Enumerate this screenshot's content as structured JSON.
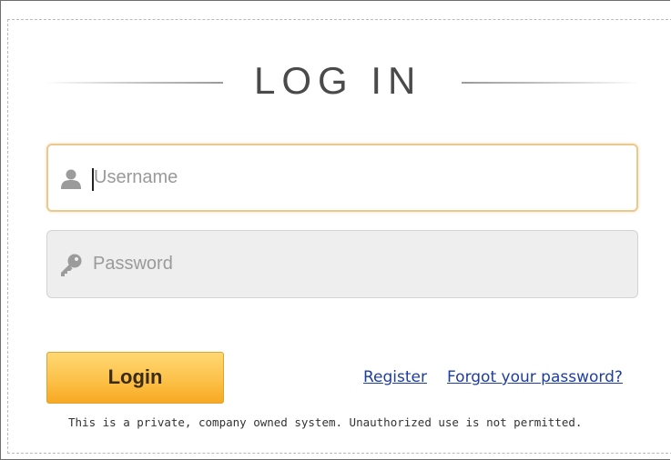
{
  "title": "LOG IN",
  "username": {
    "placeholder": "Username",
    "value": "",
    "icon": "user-icon"
  },
  "password": {
    "placeholder": "Password",
    "value": "",
    "icon": "key-icon"
  },
  "actions": {
    "login_label": "Login",
    "register_label": "Register",
    "forgot_label": "Forgot your password?"
  },
  "notice": "This is a private, company owned system. Unauthorized use is not permitted.",
  "colors": {
    "button_top": "#ffd873",
    "button_bottom": "#f7a921",
    "focus_border": "#eac98e",
    "link": "#1f3e9c",
    "title": "#4a4a4a"
  }
}
